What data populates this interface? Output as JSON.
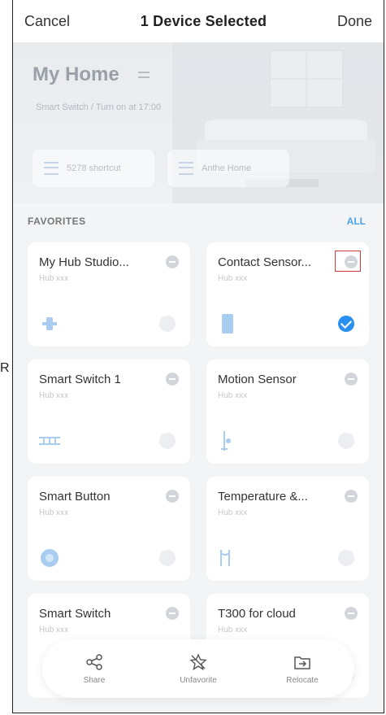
{
  "topbar": {
    "cancel": "Cancel",
    "title": "1 Device Selected",
    "done": "Done"
  },
  "side_letter": "R",
  "home": {
    "name": "My Home",
    "subtitle": "Smart Switch / Turn on at 17:00",
    "shortcuts": [
      {
        "label": "5278 shortcut"
      },
      {
        "label": "Anthe Home"
      }
    ]
  },
  "favorites": {
    "title": "FAVORITES",
    "all": "ALL"
  },
  "devices": [
    {
      "name": "My Hub Studio...",
      "sub": "Hub xxx",
      "icon": "hub-icon",
      "selected": false
    },
    {
      "name": "Contact Sensor...",
      "sub": "Hub xxx",
      "icon": "contact-sensor-icon",
      "selected": true
    },
    {
      "name": "Smart Switch 1",
      "sub": "Hub xxx",
      "icon": "switch-icon",
      "selected": false
    },
    {
      "name": "Motion Sensor",
      "sub": "Hub xxx",
      "icon": "motion-sensor-icon",
      "selected": false
    },
    {
      "name": "Smart Button",
      "sub": "Hub xxx",
      "icon": "button-icon",
      "selected": false
    },
    {
      "name": "Temperature &...",
      "sub": "Hub xxx",
      "icon": "temperature-icon",
      "selected": false
    },
    {
      "name": "Smart Switch",
      "sub": "Hub xxx",
      "icon": "switch-icon",
      "selected": false
    },
    {
      "name": "T300 for cloud",
      "sub": "Hub xxx",
      "icon": "cloud-device-icon",
      "selected": false
    }
  ],
  "actions": [
    {
      "label": "Share",
      "icon": "share-icon"
    },
    {
      "label": "Unfavorite",
      "icon": "unfavorite-icon"
    },
    {
      "label": "Relocate",
      "icon": "relocate-icon"
    }
  ],
  "colors": {
    "accent": "#2a8ff0",
    "link": "#4aa3e8",
    "highlight": "#d23b3b"
  }
}
